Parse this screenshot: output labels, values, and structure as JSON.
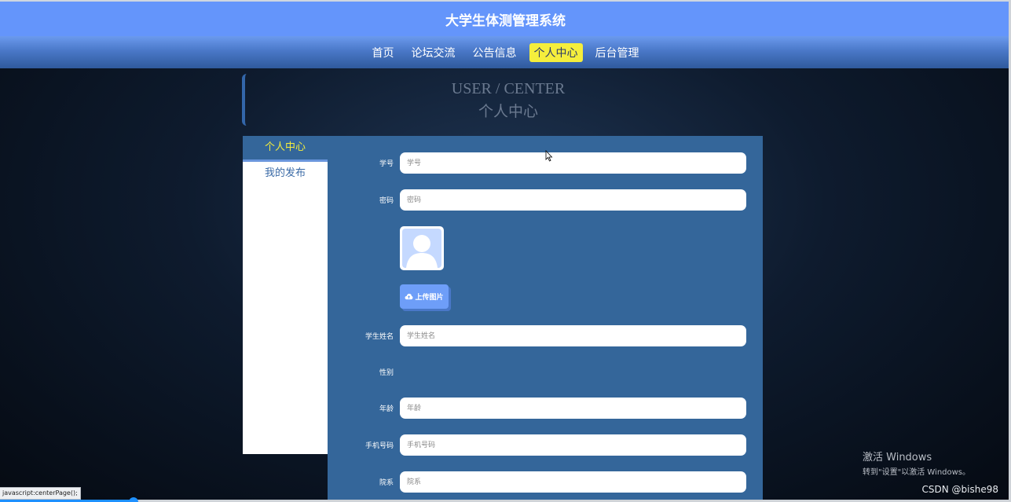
{
  "header": {
    "site_title": "大学生体测管理系统"
  },
  "nav": {
    "items": [
      {
        "label": "首页",
        "active": false
      },
      {
        "label": "论坛交流",
        "active": false
      },
      {
        "label": "公告信息",
        "active": false
      },
      {
        "label": "个人中心",
        "active": true
      },
      {
        "label": "后台管理",
        "active": false
      }
    ]
  },
  "section": {
    "title_en": "USER / CENTER",
    "title_cn": "个人中心"
  },
  "sidebar": {
    "items": [
      {
        "label": "个人中心",
        "active": true
      },
      {
        "label": "我的发布",
        "active": false
      }
    ]
  },
  "form": {
    "student_id": {
      "label": "学号",
      "placeholder": "学号",
      "value": ""
    },
    "password": {
      "label": "密码",
      "placeholder": "密码",
      "value": ""
    },
    "upload_label": "上传图片",
    "student_name": {
      "label": "学生姓名",
      "placeholder": "学生姓名",
      "value": ""
    },
    "gender": {
      "label": "性别"
    },
    "age": {
      "label": "年龄",
      "placeholder": "年龄",
      "value": ""
    },
    "phone": {
      "label": "手机号码",
      "placeholder": "手机号码",
      "value": ""
    },
    "department": {
      "label": "院系",
      "placeholder": "院系",
      "value": ""
    }
  },
  "status_bar": {
    "url": "javascript:centerPage();"
  },
  "overlay": {
    "activate_title": "激活 Windows",
    "activate_sub": "转到\"设置\"以激活 Windows。",
    "watermark": "CSDN @bishe98"
  },
  "colors": {
    "header_bg": "#6495fb",
    "active_nav": "#f5ee3c",
    "panel_bg": "#34669a",
    "upload_btn": "#6e9ef8"
  },
  "icons": {
    "avatar": "user-avatar-icon",
    "upload": "cloud-upload-icon",
    "cursor": "mouse-pointer-icon"
  }
}
